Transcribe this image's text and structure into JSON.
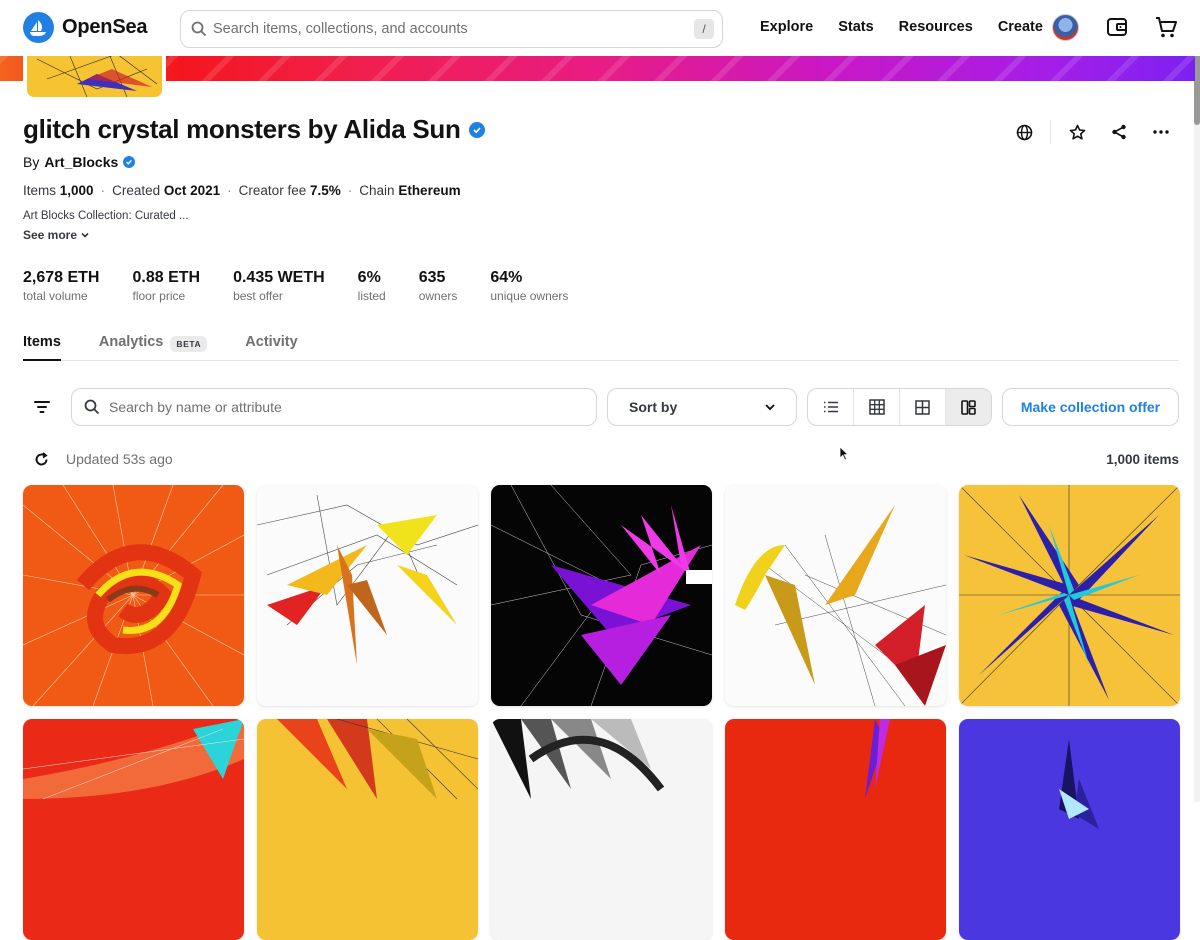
{
  "nav": {
    "brand": "OpenSea",
    "search_placeholder": "Search items, collections, and accounts",
    "search_shortcut": "/",
    "links": [
      "Explore",
      "Stats",
      "Resources",
      "Create"
    ]
  },
  "collection": {
    "title": "glitch crystal monsters by Alida Sun",
    "by_label": "By",
    "creator": "Art_Blocks",
    "meta": [
      {
        "label": "Items",
        "value": "1,000"
      },
      {
        "label": "Created",
        "value": "Oct 2021"
      },
      {
        "label": "Creator fee",
        "value": "7.5%"
      },
      {
        "label": "Chain",
        "value": "Ethereum"
      }
    ],
    "description": "Art Blocks Collection: Curated ...",
    "see_more": "See more",
    "stats": [
      {
        "value": "2,678 ETH",
        "label": "total volume"
      },
      {
        "value": "0.88 ETH",
        "label": "floor price"
      },
      {
        "value": "0.435 WETH",
        "label": "best offer"
      },
      {
        "value": "6%",
        "label": "listed"
      },
      {
        "value": "635",
        "label": "owners"
      },
      {
        "value": "64%",
        "label": "unique owners"
      }
    ]
  },
  "tabs": [
    {
      "label": "Items",
      "active": true
    },
    {
      "label": "Analytics",
      "badge": "BETA"
    },
    {
      "label": "Activity"
    }
  ],
  "toolbar": {
    "search_placeholder": "Search by name or attribute",
    "sort_label": "Sort by",
    "offer_button": "Make collection offer",
    "updated": "Updated 53s ago",
    "item_count": "1,000 items"
  },
  "colors": {
    "accent": "#2081e2",
    "text": "#121212",
    "muted": "#707070"
  }
}
